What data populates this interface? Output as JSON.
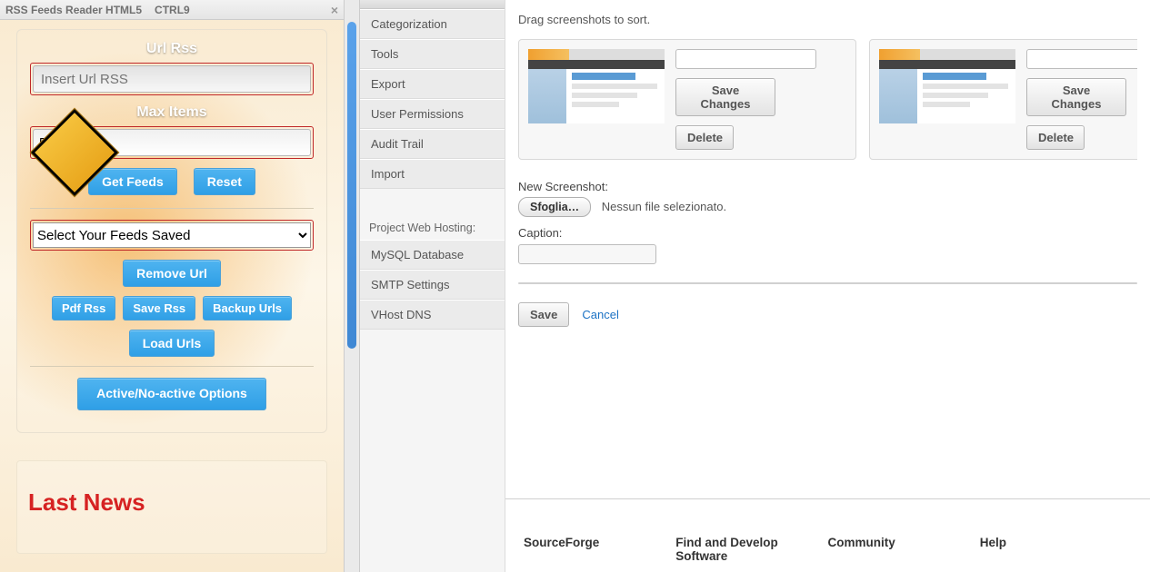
{
  "titlebar": {
    "title": "RSS Feeds Reader HTML5",
    "hotkey": "CTRL9"
  },
  "rss": {
    "url_label": "Url Rss",
    "url_placeholder": "Insert Url RSS",
    "max_items_label": "Max Items",
    "max_items_value": "5",
    "get_feeds": "Get Feeds",
    "reset": "Reset",
    "select_placeholder": "Select Your Feeds Saved",
    "remove_url": "Remove Url",
    "pdf_rss": "Pdf Rss",
    "save_rss": "Save Rss",
    "backup_urls": "Backup Urls",
    "load_urls": "Load Urls",
    "active_options": "Active/No-active Options"
  },
  "last_news": {
    "heading": "Last News"
  },
  "nav": {
    "items": [
      "Categorization",
      "Tools",
      "Export",
      "User Permissions",
      "Audit Trail",
      "Import"
    ],
    "hosting_header": "Project Web Hosting:",
    "hosting_items": [
      "MySQL Database",
      "SMTP Settings",
      "VHost DNS"
    ]
  },
  "screenshots": {
    "instruction": "Drag screenshots to sort.",
    "save_changes": "Save Changes",
    "delete": "Delete",
    "new_label": "New Screenshot:",
    "browse": "Sfoglia…",
    "no_file": "Nessun file selezionato.",
    "caption_label": "Caption:",
    "save": "Save",
    "cancel": "Cancel"
  },
  "footer": {
    "cols": [
      "SourceForge",
      "Find and Develop Software",
      "Community",
      "Help"
    ]
  }
}
